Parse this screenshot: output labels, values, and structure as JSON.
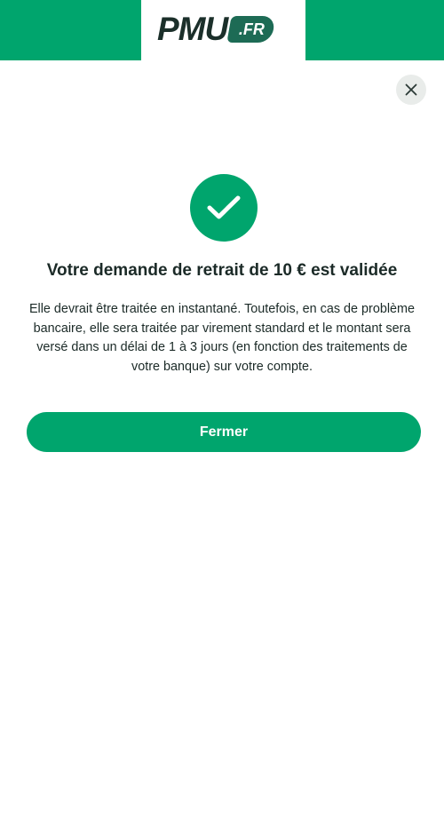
{
  "header": {
    "logo_text": "PMU",
    "logo_badge": ".FR"
  },
  "close_button": {
    "icon": "close-icon"
  },
  "success": {
    "icon": "check-icon",
    "title": "Votre demande de retrait de 10 € est validée",
    "description": "Elle devrait être traitée en instantané. Toutefois, en cas de problème bancaire, elle sera traitée par virement standard et le montant sera versé dans un délai de 1 à 3 jours (en fonction des traitements de votre banque) sur votre compte."
  },
  "actions": {
    "close_label": "Fermer"
  },
  "colors": {
    "brand_green": "#00a56d",
    "logo_dark": "#1b2f2a",
    "badge_green": "#1d6b55",
    "close_bg": "#e9ecea"
  }
}
